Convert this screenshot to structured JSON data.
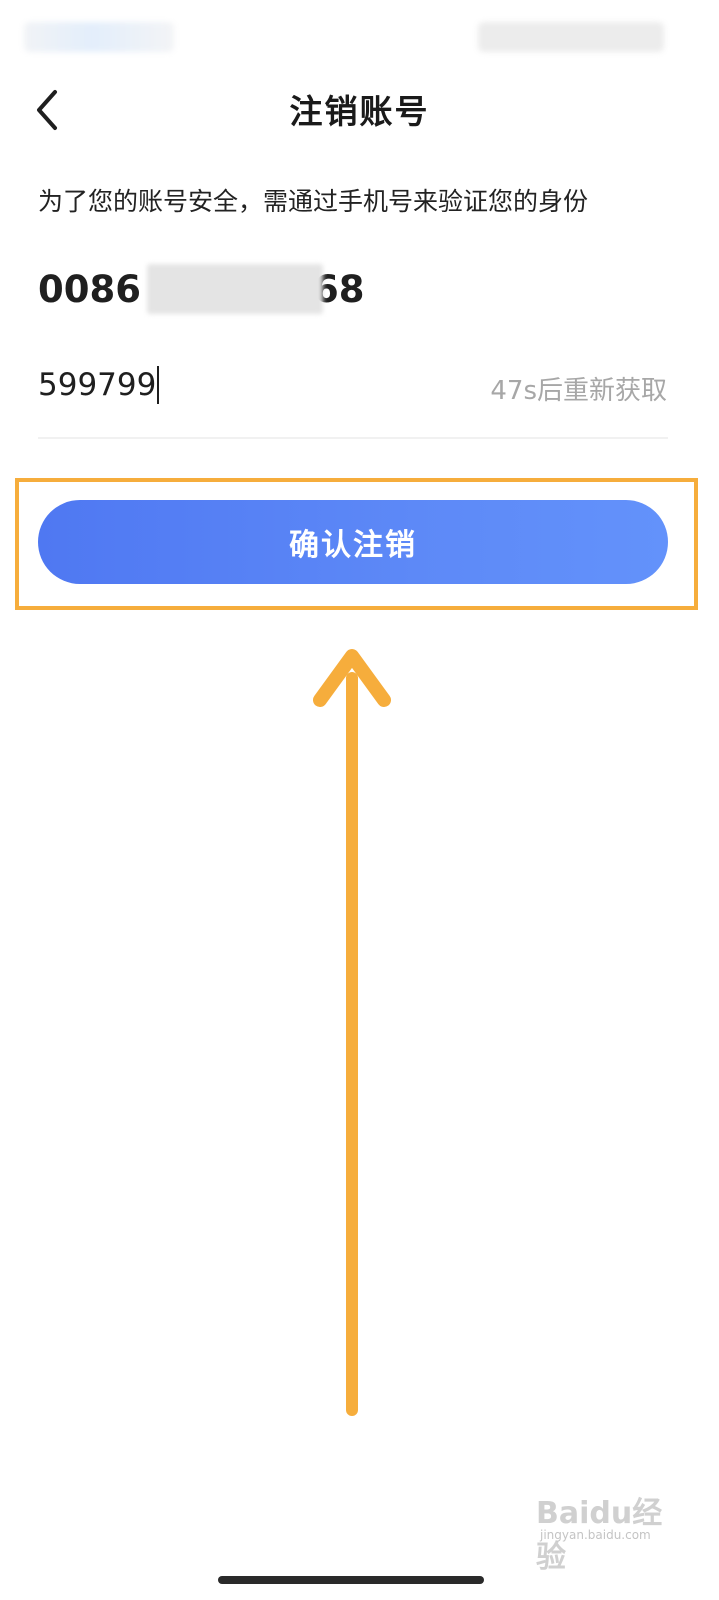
{
  "header": {
    "title": "注销账号",
    "back_icon": "chevron-left-icon"
  },
  "instruction": "为了您的账号安全，需通过手机号来验证您的身份",
  "phone": {
    "prefix": "0086",
    "suffix": "68"
  },
  "code": {
    "value": "599799",
    "resend_label": "47s后重新获取"
  },
  "confirm_button": {
    "label": "确认注销"
  },
  "annotation": {
    "highlight_color": "#f6ad3c",
    "arrow_color": "#f6ad3c"
  },
  "watermark": {
    "brand": "Baidu经验",
    "url": "jingyan.baidu.com"
  },
  "colors": {
    "accent": "#5b84f6",
    "resend_text": "#a7a7a7"
  }
}
